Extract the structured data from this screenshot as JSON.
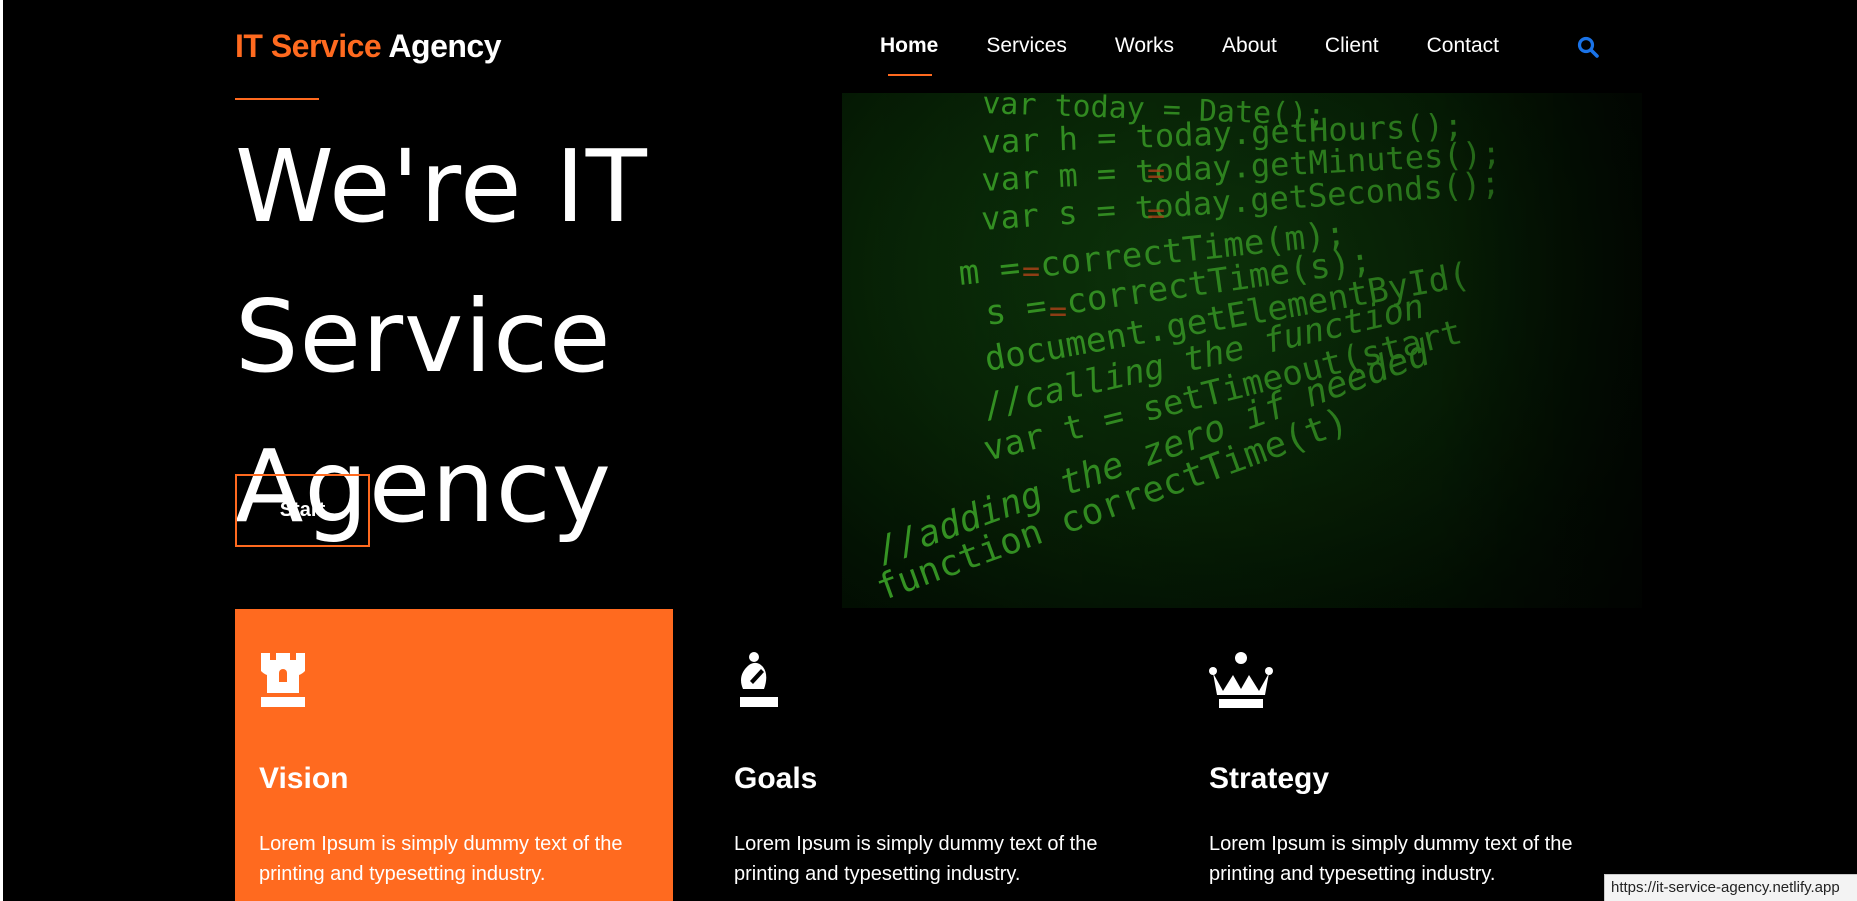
{
  "brand": {
    "accent_text": "IT Service",
    "rest_text": "Agency",
    "accent_color": "#ff6a1f"
  },
  "nav": {
    "items": [
      {
        "label": "Home",
        "active": true
      },
      {
        "label": "Services",
        "active": false
      },
      {
        "label": "Works",
        "active": false
      },
      {
        "label": "About",
        "active": false
      },
      {
        "label": "Client",
        "active": false
      },
      {
        "label": "Contact",
        "active": false
      }
    ],
    "search_icon": "search-icon"
  },
  "hero": {
    "title_line1": "We're IT Service",
    "title_line2": "Agency",
    "start_label": "Start",
    "image_icon": "code-screen-image"
  },
  "cards": [
    {
      "icon": "rook-icon",
      "title": "Vision",
      "text": "Lorem Ipsum is simply dummy text of the printing and typesetting industry.",
      "highlight": true
    },
    {
      "icon": "knight-icon",
      "title": "Goals",
      "text": "Lorem Ipsum is simply dummy text of the printing and typesetting industry.",
      "highlight": false
    },
    {
      "icon": "crown-icon",
      "title": "Strategy",
      "text": "Lorem Ipsum is simply dummy text of the printing and typesetting industry.",
      "highlight": false
    }
  ],
  "status_bar": {
    "url": "https://it-service-agency.netlify.app"
  },
  "colors": {
    "background": "#000000",
    "accent": "#ff6a1f",
    "search": "#1a73e8",
    "code_green": "#3fae2a"
  }
}
